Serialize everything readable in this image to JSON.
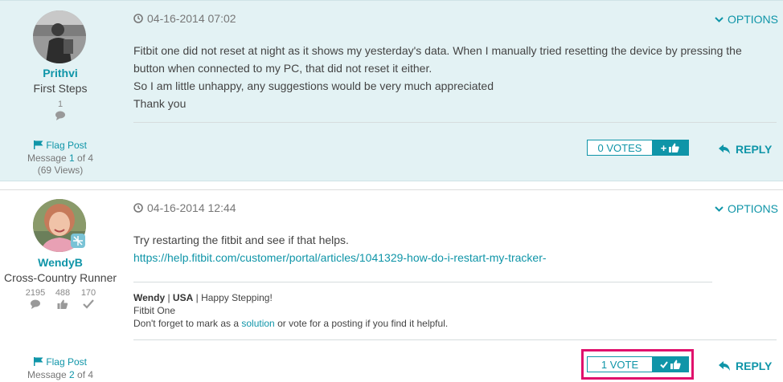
{
  "posts": [
    {
      "author": "Prithvi",
      "rank": "First Steps",
      "stats": {
        "messages": "1"
      },
      "flag_label": "Flag Post",
      "message_prefix": "Message",
      "message_index": "1",
      "message_of": "of 4",
      "views": "(69 Views)",
      "date": "04-16-2014 07:02",
      "options_label": "OPTIONS",
      "body": [
        "Fitbit one did not reset at night as it shows my yesterday's data. When I manually tried resetting the device by pressing the",
        "button when connected to my PC, that did not reset it either.",
        "So I am little unhappy, any suggestions would be very much appreciated",
        "Thank you"
      ],
      "votes_label": "0 VOTES",
      "kudo_symbol": "+",
      "reply_label": "REPLY"
    },
    {
      "author": "WendyB",
      "rank": "Cross-Country Runner",
      "stats": {
        "messages": "2195",
        "kudos": "488",
        "solutions": "170"
      },
      "flag_label": "Flag Post",
      "message_prefix": "Message",
      "message_index": "2",
      "message_of": "of 4",
      "date": "04-16-2014 12:44",
      "options_label": "OPTIONS",
      "body": [
        "Try restarting the fitbit and see if that helps."
      ],
      "link": "https://help.fitbit.com/customer/portal/articles/1041329-how-do-i-restart-my-tracker-",
      "signature": {
        "name": "Wendy",
        "sep1": " | ",
        "country": "USA",
        "sep2": " | ",
        "motto": "Happy Stepping!",
        "device": "Fitbit One",
        "note_before": "Don't forget to mark as a ",
        "note_link": "solution",
        "note_after": " or vote for a posting if you find it helpful."
      },
      "votes_label": "1 VOTE",
      "reply_label": "REPLY"
    }
  ],
  "colors": {
    "accent": "#0f95a8",
    "highlight": "#e0116c",
    "post1_bg": "#e3f2f4"
  }
}
